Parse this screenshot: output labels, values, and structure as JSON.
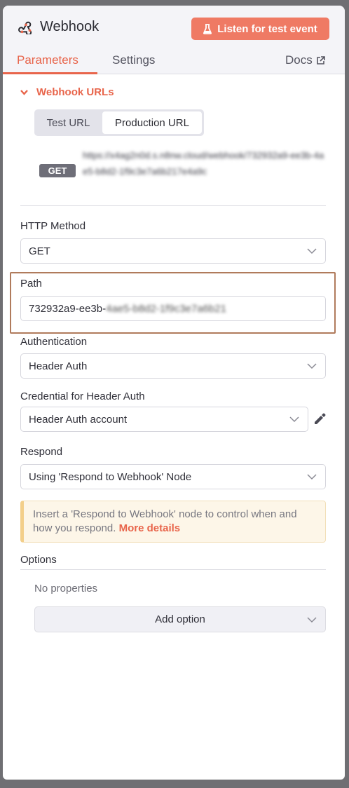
{
  "header": {
    "title": "Webhook",
    "listen_button": "Listen for test event",
    "tabs": [
      {
        "label": "Parameters",
        "active": true
      },
      {
        "label": "Settings",
        "active": false
      }
    ],
    "docs_label": "Docs"
  },
  "webhook_urls": {
    "section_label": "Webhook URLs",
    "url_tabs": [
      {
        "label": "Test URL",
        "active": false
      },
      {
        "label": "Production URL",
        "active": true
      }
    ],
    "method_badge": "GET",
    "url_value": "https://x4ag2n0d.s.n8nw.cloud/webhook/732932a9-ee3b-4ae5-b8d2-1f9c3e7a6b217e4a9c"
  },
  "http_method": {
    "label": "HTTP Method",
    "value": "GET"
  },
  "path": {
    "label": "Path",
    "value_prefix": "732932a9-ee3b-",
    "value_suffix": "4ae5-b8d2-1f9c3e7a6b21"
  },
  "authentication": {
    "label": "Authentication",
    "value": "Header Auth"
  },
  "credential": {
    "label": "Credential for Header Auth",
    "value": "Header Auth account"
  },
  "respond": {
    "label": "Respond",
    "value": "Using 'Respond to Webhook' Node"
  },
  "notice": {
    "text": "Insert a 'Respond to Webhook' node to control when and how you respond.",
    "link": "More details"
  },
  "options": {
    "label": "Options",
    "empty_text": "No properties",
    "add_button": "Add option"
  },
  "colors": {
    "accent": "#e8654b",
    "button": "#ef7a64",
    "highlight_border": "#b07b5c"
  },
  "icons": [
    "webhook-logo-icon",
    "flask-icon",
    "external-link-icon",
    "chevron-down-icon",
    "pencil-icon"
  ]
}
